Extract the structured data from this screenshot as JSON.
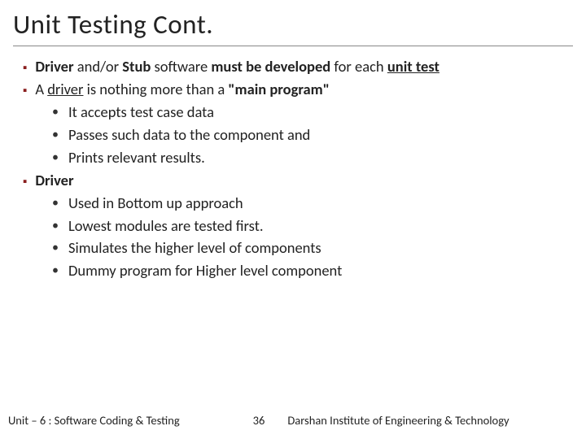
{
  "title": "Unit Testing Cont.",
  "point1_pre": "Driver",
  "point1_mid1": " and/or ",
  "point1_stub": "Stub",
  "point1_mid2": " software ",
  "point1_must": "must be developed",
  "point1_mid3": " for each ",
  "point1_unit": "unit test",
  "point2_pre": "A ",
  "point2_driver": "driver",
  "point2_mid": " is nothing more than a ",
  "point2_main": "\"main program\"",
  "sub1": "It accepts test case data",
  "sub2": "Passes such data to the component and",
  "sub3": "Prints relevant results.",
  "point3": "Driver",
  "sub4": "Used in Bottom up approach",
  "sub5": "Lowest modules are tested first.",
  "sub6": "Simulates the higher level of components",
  "sub7": "Dummy program for Higher level component",
  "footer_left": "Unit – 6 : Software Coding & Testing",
  "footer_page": "36",
  "footer_right": "Darshan Institute of Engineering & Technology"
}
